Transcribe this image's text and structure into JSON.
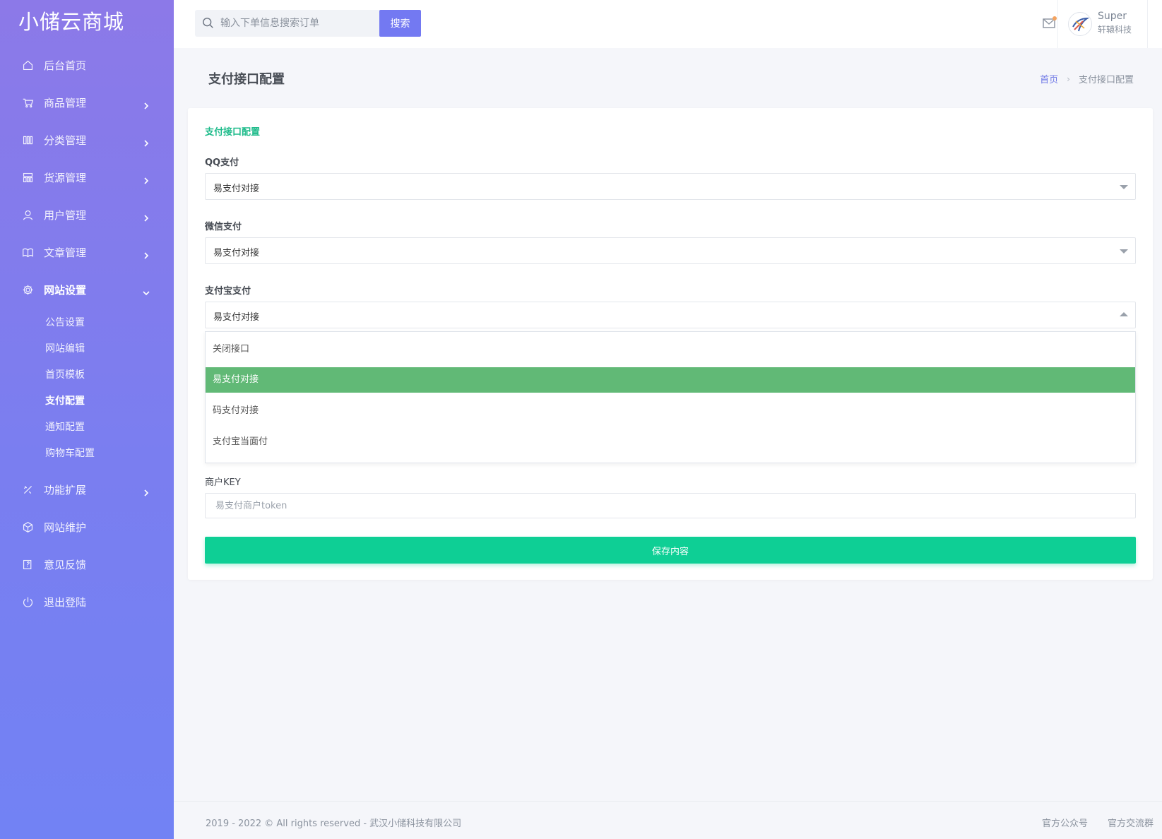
{
  "brand": "小储云商城",
  "sidebar": {
    "items": [
      {
        "label": "后台首页",
        "icon": "home-icon",
        "has_arrow": false
      },
      {
        "label": "商品管理",
        "icon": "cart-icon",
        "has_arrow": true
      },
      {
        "label": "分类管理",
        "icon": "columns-icon",
        "has_arrow": true
      },
      {
        "label": "货源管理",
        "icon": "grid-icon",
        "has_arrow": true
      },
      {
        "label": "用户管理",
        "icon": "user-icon",
        "has_arrow": true
      },
      {
        "label": "文章管理",
        "icon": "book-icon",
        "has_arrow": true
      },
      {
        "label": "网站设置",
        "icon": "gear-icon",
        "has_arrow": true,
        "expanded": true
      },
      {
        "label": "功能扩展",
        "icon": "tools-icon",
        "has_arrow": true
      },
      {
        "label": "网站维护",
        "icon": "cube-icon",
        "has_arrow": false
      },
      {
        "label": "意见反馈",
        "icon": "feedback-icon",
        "has_arrow": false
      },
      {
        "label": "退出登陆",
        "icon": "power-icon",
        "has_arrow": false
      }
    ],
    "submenu": [
      "公告设置",
      "网站编辑",
      "首页模板",
      "支付配置",
      "通知配置",
      "购物车配置"
    ],
    "active_sub": "支付配置"
  },
  "topbar": {
    "search_placeholder": "输入下单信息搜索订单",
    "search_button": "搜索",
    "user_name": "Super",
    "user_org": "轩辕科技"
  },
  "page": {
    "title": "支付接口配置",
    "breadcrumb_home": "首页",
    "breadcrumb_current": "支付接口配置"
  },
  "form": {
    "section_title": "支付接口配置",
    "qq_label": "QQ支付",
    "qq_value": "易支付对接",
    "wechat_label": "微信支付",
    "wechat_value": "易支付对接",
    "alipay_label": "支付宝支付",
    "alipay_value": "易支付对接",
    "dropdown_options": [
      "关闭接口",
      "易支付对接",
      "码支付对接",
      "支付宝当面付"
    ],
    "dropdown_selected": "易支付对接",
    "key_label": "商户KEY",
    "key_placeholder": "易支付商户token",
    "save_button": "保存内容"
  },
  "footer": {
    "copyright": "2019 - 2022 © All rights reserved - 武汉小储科技有限公司",
    "link1": "官方公众号",
    "link2": "官方交流群"
  },
  "colors": {
    "sidebar_top": "#8c79e8",
    "sidebar_bottom": "#7282f4",
    "accent": "#7379f2",
    "section_green": "#1dbb8a",
    "save_green": "#0ecf95",
    "option_selected": "#61b976"
  }
}
